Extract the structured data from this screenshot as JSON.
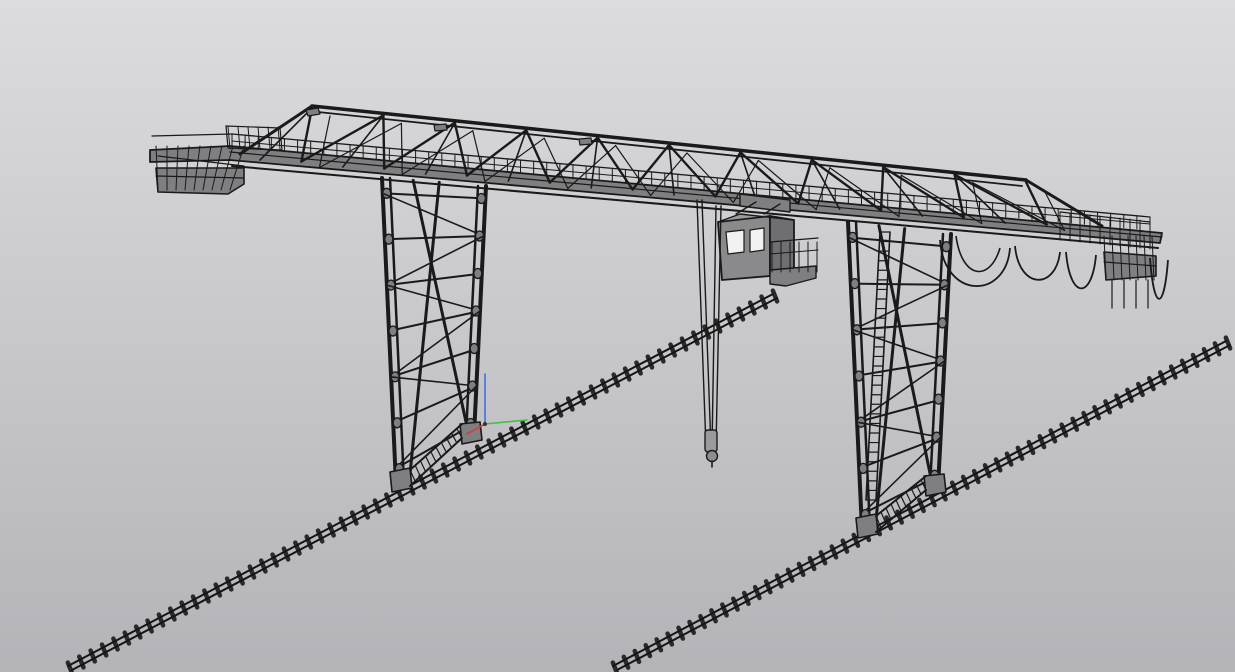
{
  "viewport": {
    "background_top": "#dcdcdf",
    "background_bottom": "#b3b3b8"
  },
  "model": {
    "line_color": "#1a1a1a",
    "fill_color": "#7f7f82",
    "cab_fill_color": "#8a8a8d"
  },
  "triad": {
    "x_axis_color": "#d04040",
    "y_axis_color": "#40c040",
    "z_axis_color": "#4070e0"
  },
  "icons": [
    "gantry-crane-model",
    "coordinate-triad-icon"
  ]
}
